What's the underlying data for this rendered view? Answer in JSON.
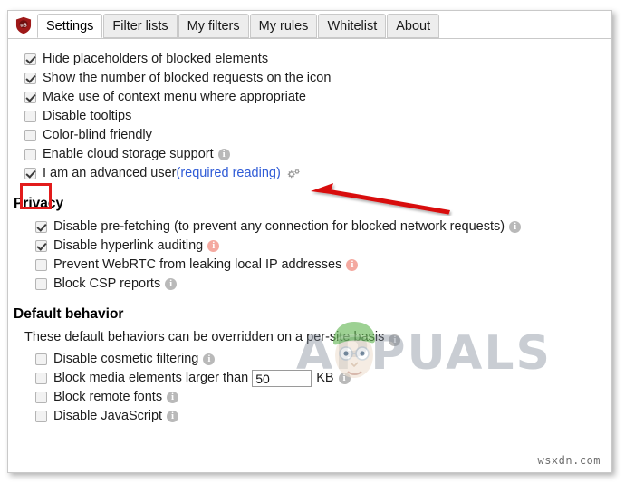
{
  "window": {
    "logo_icon": "ublock-shield-icon",
    "logo_text": "uB"
  },
  "tabs": [
    {
      "label": "Settings",
      "active": true
    },
    {
      "label": "Filter lists",
      "active": false
    },
    {
      "label": "My filters",
      "active": false
    },
    {
      "label": "My rules",
      "active": false
    },
    {
      "label": "Whitelist",
      "active": false
    },
    {
      "label": "About",
      "active": false
    }
  ],
  "general_options": [
    {
      "label": "Hide placeholders of blocked elements",
      "checked": true,
      "info": false
    },
    {
      "label": "Show the number of blocked requests on the icon",
      "checked": true,
      "info": false
    },
    {
      "label": "Make use of context menu where appropriate",
      "checked": true,
      "info": false
    },
    {
      "label": "Disable tooltips",
      "checked": false,
      "info": false
    },
    {
      "label": "Color-blind friendly",
      "checked": false,
      "info": false
    },
    {
      "label": "Enable cloud storage support",
      "checked": false,
      "info": true,
      "info_color": "gray"
    }
  ],
  "advanced_user": {
    "label_prefix": "I am an advanced user ",
    "link_text": "(required reading)",
    "checked": true,
    "gear_icon": "gears-icon"
  },
  "privacy": {
    "heading": "Privacy",
    "options": [
      {
        "label": "Disable pre-fetching (to prevent any connection for blocked network requests)",
        "checked": true,
        "info": true,
        "info_color": "gray"
      },
      {
        "label": "Disable hyperlink auditing",
        "checked": true,
        "info": true,
        "info_color": "salmon"
      },
      {
        "label": "Prevent WebRTC from leaking local IP addresses",
        "checked": false,
        "info": true,
        "info_color": "salmon"
      },
      {
        "label": "Block CSP reports",
        "checked": false,
        "info": true,
        "info_color": "gray"
      }
    ]
  },
  "default_behavior": {
    "heading": "Default behavior",
    "note": "These default behaviors can be overridden on a per-site basis",
    "note_info": true,
    "options": [
      {
        "label": "Disable cosmetic filtering",
        "checked": false,
        "info": true,
        "info_color": "gray"
      },
      {
        "label": "Block media elements larger than",
        "checked": false,
        "info": true,
        "info_color": "gray",
        "has_input": true,
        "input_value": "50",
        "input_placeholder": "",
        "unit": "KB"
      },
      {
        "label": "Block remote fonts",
        "checked": false,
        "info": true,
        "info_color": "gray"
      },
      {
        "label": "Disable JavaScript",
        "checked": false,
        "info": true,
        "info_color": "gray"
      }
    ]
  },
  "annotations": {
    "highlight_box_color": "#e21b1b",
    "arrow_color": "#d80f0f",
    "highlight_target": "advanced-user-checkbox",
    "arrow_direction": "left"
  },
  "watermarks": {
    "appuals": "APPUALS",
    "site": "wsxdn.com"
  }
}
